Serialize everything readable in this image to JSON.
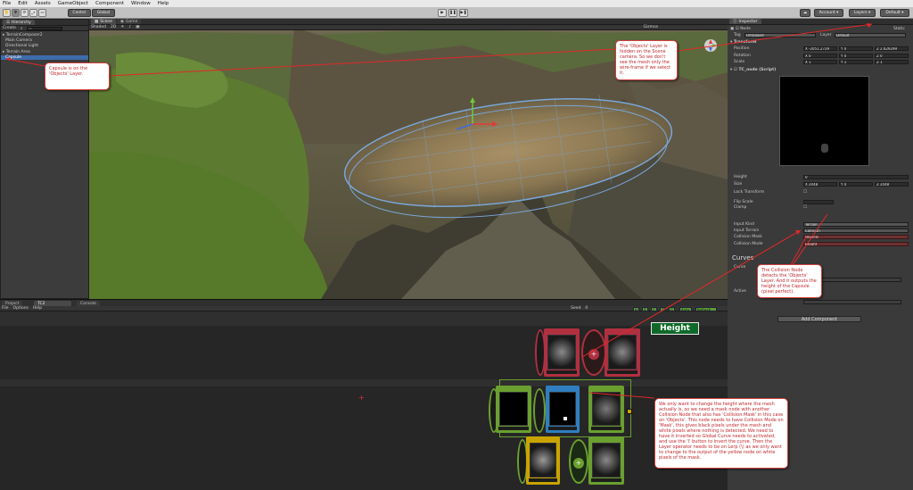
{
  "menu": [
    "File",
    "Edit",
    "Assets",
    "GameObject",
    "Component",
    "Window",
    "Help"
  ],
  "toolbar": {
    "pivot_label": "Center",
    "space_label": "Global",
    "play": "▶",
    "pause": "❚❚",
    "step": "▶❚",
    "account_label": "Account",
    "layers_label": "Layers",
    "layout_label": "Default"
  },
  "hierarchy": {
    "tab_label": "Hierarchy",
    "create_label": "Create",
    "search_placeholder": "All",
    "items": [
      "TerrainComposer2",
      "Main Camera",
      "Directional Light",
      "Terrain Area",
      "Capsule"
    ]
  },
  "scene": {
    "tab_label": "Scene",
    "game_tab_label": "Game",
    "shading_label": "Shaded",
    "mode_label": "2D",
    "gizmos_label": "Gizmos"
  },
  "inspector": {
    "tab_label": "Inspector",
    "object_name": "Node",
    "static_label": "Static",
    "tag_label": "Tag",
    "tag_value": "Untagged",
    "layer_label": "Layer",
    "layer_value": "Default",
    "transform_label": "Transform",
    "position_label": "Position",
    "position": [
      "X -2051.2729",
      "Y 0",
      "Z 2.629299"
    ],
    "rotation_label": "Rotation",
    "rotation": [
      "X 0",
      "Y 0",
      "Z 0"
    ],
    "scale_label": "Scale",
    "scale": [
      "X 1",
      "Y 1",
      "Z 1"
    ],
    "script_label": "TC_node (Script)",
    "height_label": "Height",
    "height_value": "0",
    "size_label": "Size",
    "size_values": [
      "X 2048",
      "Y 0",
      "Z 2048"
    ],
    "lock_transform_label": "Lock Transform",
    "flip_scale_label": "Flip Scale",
    "clamp_label": "Clamp",
    "input_kind_label": "Input Kind",
    "input_kind_value": "Terrain",
    "input_terrain_label": "Input Terrain",
    "input_terrain_value": "Collision",
    "collision_mask_label": "Collision Mask",
    "collision_mask_value": "Objects",
    "collision_mode_label": "Collision Mode",
    "collision_mode_value": "Height",
    "curves_label": "Curves",
    "curve_label": "Curve",
    "active_label": "Active",
    "add_component_label": "Add Component"
  },
  "bottom": {
    "project_tab": "Project",
    "tc2_tab": "TC2",
    "console_tab": "Console",
    "file_label": "File",
    "options_label": "Options",
    "help_label": "Help",
    "seed_label": "Seed",
    "seed_value": "0",
    "auto_label": "Auto",
    "refresh_label": "Refresh"
  },
  "height_label": "Height",
  "callouts": {
    "capsule": "Capsule is on the 'Objects' Layer.",
    "layer_hidden": "The 'Objects' Layer is hidden on the Scene camera. So we don't see the mesh only the wire-frame if we select it.",
    "collision_node": "The Collision Node detects the 'Objects' Layer. And it outputs the height of the Capsule (pixel perfect).",
    "mask": "We only want to change the height where the mesh actually is, so we need a mask node with another Collision Node that also has 'Collision Mask' in this case on 'Objects'. This node needs to have Collision Mode on 'Mask', this gives black pixels under the mesh and white pixels where nothing is detected. We need to have it inverted so Global Curve needs to activated, and use the 'I' button to invert the curve. Then the Layer operator needs to be on Lerp (\\) as we only want to change to the output of the yellow node on white pixels of the mask."
  },
  "colors": {
    "selection": "#3d6caa",
    "node_green": "#6aa02f",
    "node_red": "#b03040",
    "node_yellow": "#c9a400",
    "node_blue": "#2f7fc0",
    "callout_text": "#c0282c",
    "height_label_bg": "#0f6a2a"
  }
}
